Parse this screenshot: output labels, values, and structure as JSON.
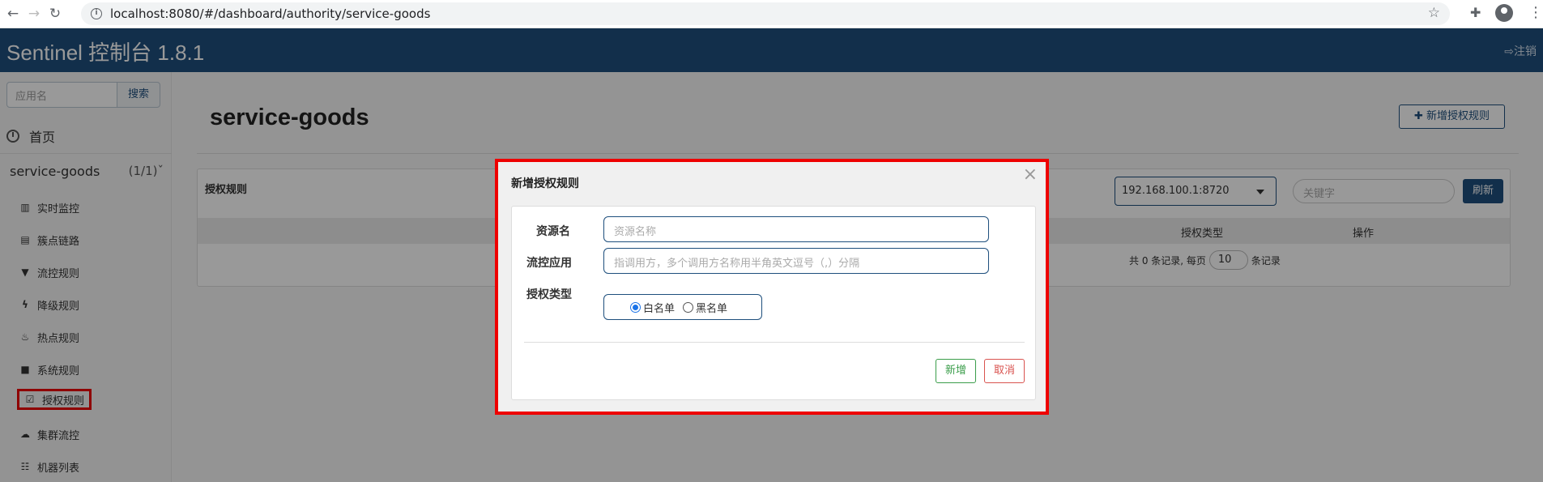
{
  "browser": {
    "url": "localhost:8080/#/dashboard/authority/service-goods"
  },
  "header": {
    "title": "Sentinel 控制台 1.8.1",
    "logout_label": "注销"
  },
  "sidebar": {
    "search_placeholder": "应用名",
    "search_button": "搜索",
    "home_label": "首页",
    "app_name": "service-goods",
    "app_count": "(1/1)",
    "items": [
      {
        "label": "实时监控",
        "icon": "bar-chart-icon"
      },
      {
        "label": "簇点链路",
        "icon": "list-icon"
      },
      {
        "label": "流控规则",
        "icon": "filter-icon"
      },
      {
        "label": "降级规则",
        "icon": "flash-icon"
      },
      {
        "label": "热点规则",
        "icon": "fire-icon"
      },
      {
        "label": "系统规则",
        "icon": "lock-icon"
      },
      {
        "label": "授权规则",
        "icon": "check-icon"
      },
      {
        "label": "集群流控",
        "icon": "cloud-icon"
      },
      {
        "label": "机器列表",
        "icon": "th-list-icon"
      }
    ]
  },
  "main": {
    "page_title": "service-goods",
    "add_button": "新增授权规则",
    "panel_title": "授权规则",
    "machine_select": "192.168.100.1:8720",
    "keyword_placeholder": "关键字",
    "refresh_button": "刷新",
    "columns": [
      "授权类型",
      "操作"
    ],
    "pager_prefix": "共 0 条记录, 每页",
    "pager_size": "10",
    "pager_suffix": "条记录"
  },
  "modal": {
    "title": "新增授权规则",
    "close": "×",
    "resource_label": "资源名",
    "resource_placeholder": "资源名称",
    "app_label": "流控应用",
    "app_placeholder": "指调用方，多个调用方名称用半角英文逗号（,）分隔",
    "type_label": "授权类型",
    "whitelist_label": "白名单",
    "blacklist_label": "黑名单",
    "add_button": "新增",
    "cancel_button": "取消"
  }
}
